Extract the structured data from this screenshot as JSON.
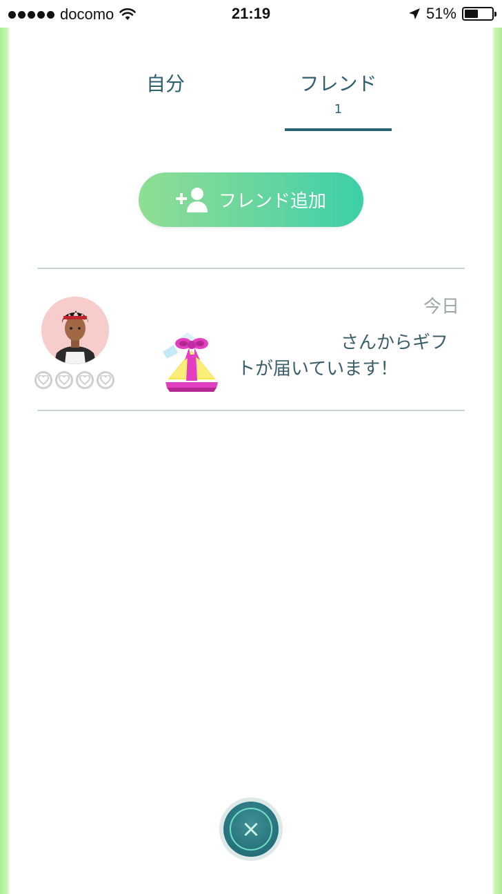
{
  "status_bar": {
    "carrier": "docomo",
    "time": "21:19",
    "battery_percent": "51%",
    "battery_level": 0.51
  },
  "tabs": [
    {
      "label": "自分",
      "active": false
    },
    {
      "label": "フレンド",
      "count": "1",
      "active": true
    }
  ],
  "add_friend_button": {
    "label": "フレンド追加",
    "icon": "add-person-icon"
  },
  "friends": [
    {
      "date": "今日",
      "message": "さんからギフトが届いています！",
      "gift_icon": "gift-box-icon",
      "hearts": 4
    }
  ],
  "close_button": {
    "icon": "close-icon"
  },
  "colors": {
    "accent": "#2a6374",
    "text": "#2e5f6e",
    "button_start": "#8fde93",
    "button_end": "#3ccfa8"
  }
}
